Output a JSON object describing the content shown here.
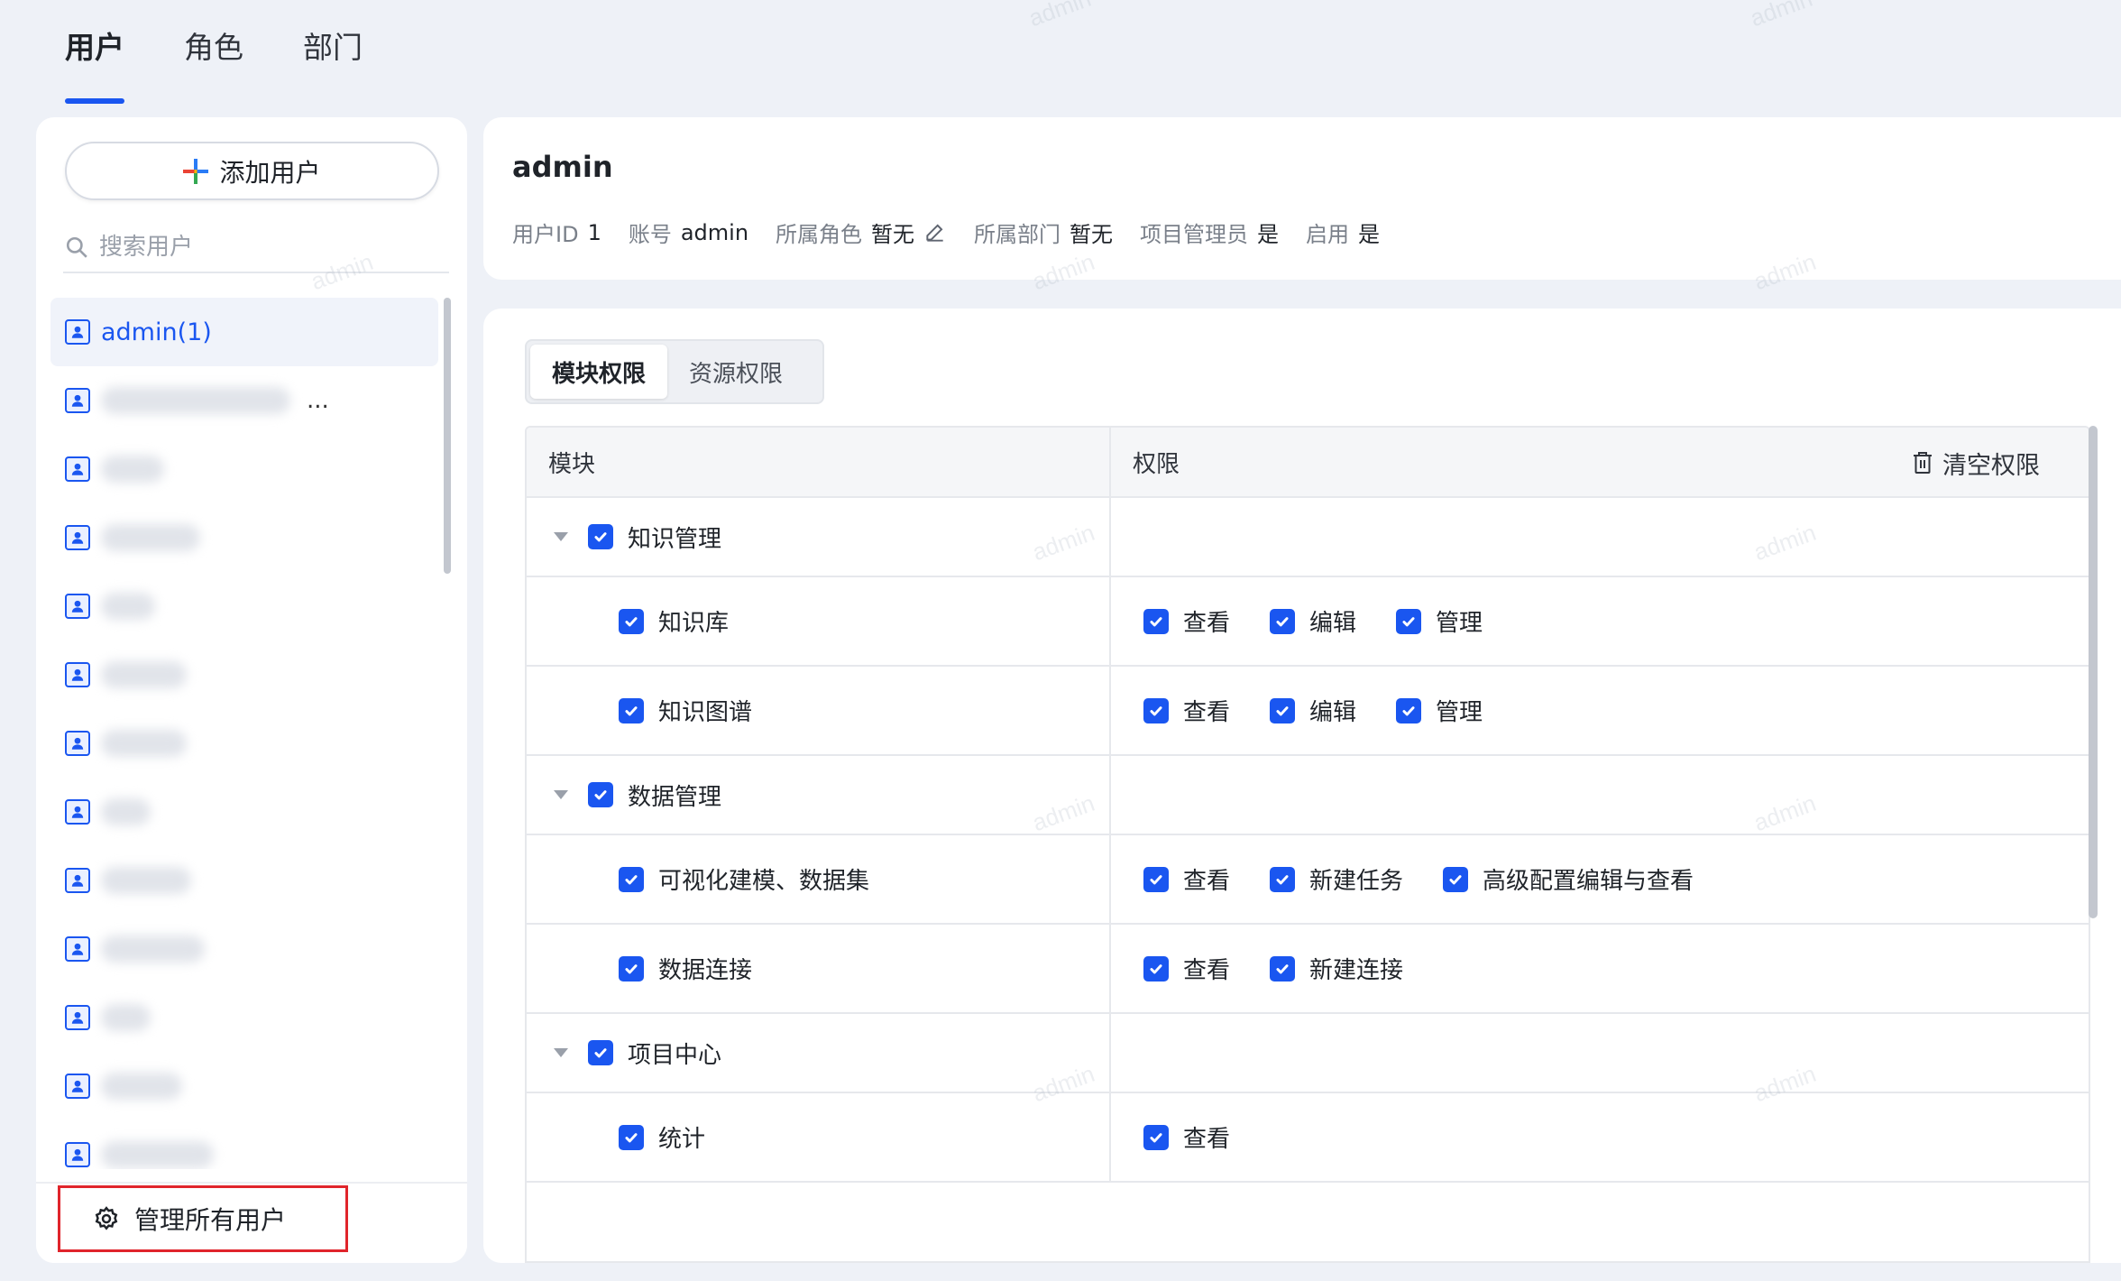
{
  "top_tabs": [
    {
      "label": "用户",
      "active": true
    },
    {
      "label": "角色",
      "active": false
    },
    {
      "label": "部门",
      "active": false
    }
  ],
  "sidebar": {
    "add_user_label": "添加用户",
    "search_placeholder": "搜索用户",
    "users": [
      {
        "name": "admin(1)",
        "active": true,
        "blurred": false
      },
      {
        "name": "",
        "blurred": true,
        "blur_width": 210,
        "has_more": true,
        "more_label": "..."
      },
      {
        "name": "",
        "blurred": true,
        "blur_width": 70
      },
      {
        "name": "",
        "blurred": true,
        "blur_width": 110
      },
      {
        "name": "",
        "blurred": true,
        "blur_width": 60
      },
      {
        "name": "",
        "blurred": true,
        "blur_width": 95
      },
      {
        "name": "",
        "blurred": true,
        "blur_width": 95
      },
      {
        "name": "",
        "blurred": true,
        "blur_width": 55
      },
      {
        "name": "",
        "blurred": true,
        "blur_width": 100
      },
      {
        "name": "",
        "blurred": true,
        "blur_width": 115
      },
      {
        "name": "",
        "blurred": true,
        "blur_width": 55
      },
      {
        "name": "",
        "blurred": true,
        "blur_width": 90
      },
      {
        "name": "",
        "blurred": true,
        "blur_width": 125
      }
    ],
    "manage_all_label": "管理所有用户"
  },
  "user_info": {
    "title": "admin",
    "fields": [
      {
        "label": "用户ID",
        "value": "1"
      },
      {
        "label": "账号",
        "value": "admin"
      },
      {
        "label": "所属角色",
        "value": "暂无",
        "editable": true
      },
      {
        "label": "所属部门",
        "value": "暂无"
      },
      {
        "label": "项目管理员",
        "value": "是"
      },
      {
        "label": "启用",
        "value": "是"
      }
    ]
  },
  "perm_tabs": [
    {
      "label": "模块权限",
      "active": true
    },
    {
      "label": "资源权限",
      "active": false
    }
  ],
  "table": {
    "col_module": "模块",
    "col_perm": "权限",
    "clear_label": "清空权限",
    "rows": [
      {
        "type": "group",
        "label": "知识管理",
        "checked": true,
        "perms": []
      },
      {
        "type": "child",
        "label": "知识库",
        "checked": true,
        "perms": [
          "查看",
          "编辑",
          "管理"
        ]
      },
      {
        "type": "child",
        "label": "知识图谱",
        "checked": true,
        "perms": [
          "查看",
          "编辑",
          "管理"
        ]
      },
      {
        "type": "group",
        "label": "数据管理",
        "checked": true,
        "perms": []
      },
      {
        "type": "child",
        "label": "可视化建模、数据集",
        "checked": true,
        "perms": [
          "查看",
          "新建任务",
          "高级配置编辑与查看"
        ]
      },
      {
        "type": "child",
        "label": "数据连接",
        "checked": true,
        "perms": [
          "查看",
          "新建连接"
        ]
      },
      {
        "type": "group",
        "label": "项目中心",
        "checked": true,
        "perms": []
      },
      {
        "type": "child",
        "label": "统计",
        "checked": true,
        "perms": [
          "查看"
        ]
      }
    ]
  },
  "watermark_text": "admin",
  "colors": {
    "accent": "#1a56f0",
    "highlight_border": "#e0242b",
    "background": "#eef1f7"
  }
}
